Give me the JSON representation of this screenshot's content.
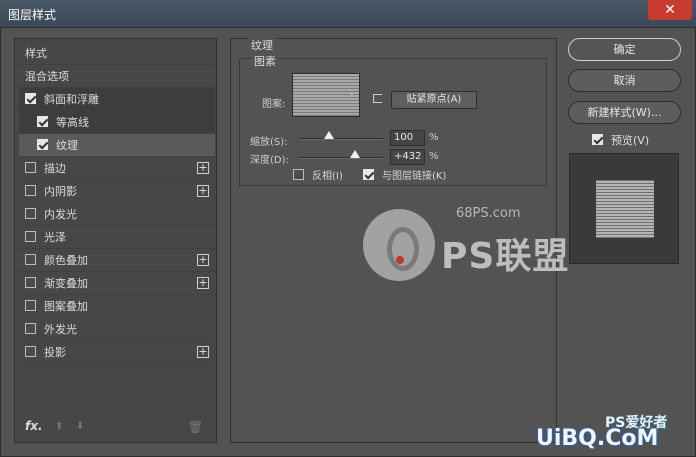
{
  "window": {
    "title": "图层样式",
    "close_glyph": "✕"
  },
  "left": {
    "items": [
      {
        "label": "样式",
        "checkbox": false,
        "checked": false,
        "plus": false,
        "child": false,
        "selected": false
      },
      {
        "label": "混合选项",
        "checkbox": false,
        "checked": false,
        "plus": false,
        "child": false,
        "selected": false
      },
      {
        "label": "斜面和浮雕",
        "checkbox": true,
        "checked": true,
        "plus": false,
        "child": false,
        "selected": true
      },
      {
        "label": "等高线",
        "checkbox": true,
        "checked": true,
        "plus": false,
        "child": true,
        "selected": true
      },
      {
        "label": "纹理",
        "checkbox": true,
        "checked": true,
        "plus": false,
        "child": true,
        "selected": true,
        "active": true
      },
      {
        "label": "描边",
        "checkbox": true,
        "checked": false,
        "plus": true,
        "child": false,
        "selected": false
      },
      {
        "label": "内阴影",
        "checkbox": true,
        "checked": false,
        "plus": true,
        "child": false,
        "selected": false
      },
      {
        "label": "内发光",
        "checkbox": true,
        "checked": false,
        "plus": false,
        "child": false,
        "selected": false
      },
      {
        "label": "光泽",
        "checkbox": true,
        "checked": false,
        "plus": false,
        "child": false,
        "selected": false
      },
      {
        "label": "颜色叠加",
        "checkbox": true,
        "checked": false,
        "plus": true,
        "child": false,
        "selected": false
      },
      {
        "label": "渐变叠加",
        "checkbox": true,
        "checked": false,
        "plus": true,
        "child": false,
        "selected": false
      },
      {
        "label": "图案叠加",
        "checkbox": true,
        "checked": false,
        "plus": false,
        "child": false,
        "selected": false
      },
      {
        "label": "外发光",
        "checkbox": true,
        "checked": false,
        "plus": false,
        "child": false,
        "selected": false
      },
      {
        "label": "投影",
        "checkbox": true,
        "checked": false,
        "plus": true,
        "child": false,
        "selected": false
      }
    ],
    "plus_glyph": "+",
    "footer": {
      "fx": "fx",
      "fx_dot": ".",
      "up_glyph": "⬆",
      "down_glyph": "⬇",
      "trash_glyph": "🗑"
    }
  },
  "texture": {
    "section_title": "纹理",
    "group_title": "图素",
    "pattern_label": "图案:",
    "pattern_arrow": "⌄",
    "snap_button": "贴紧原点(A)",
    "scale_label": "缩放(S):",
    "scale_value": "100",
    "scale_unit": "%",
    "scale_position": 0.36,
    "depth_label": "深度(D):",
    "depth_value": "+432",
    "depth_unit": "%",
    "depth_position": 0.67,
    "invert_label": "反相(I)",
    "invert_checked": false,
    "link_label": "与图层链接(K)",
    "link_checked": true
  },
  "right": {
    "ok": "确定",
    "cancel": "取消",
    "new_style": "新建样式(W)...",
    "preview_label": "预览(V)",
    "preview_checked": true
  },
  "watermark": {
    "site": "68PS.com",
    "brand": "PS联盟",
    "corner_top": "PS爱好者",
    "corner_bottom": "UiBQ.CoM"
  }
}
